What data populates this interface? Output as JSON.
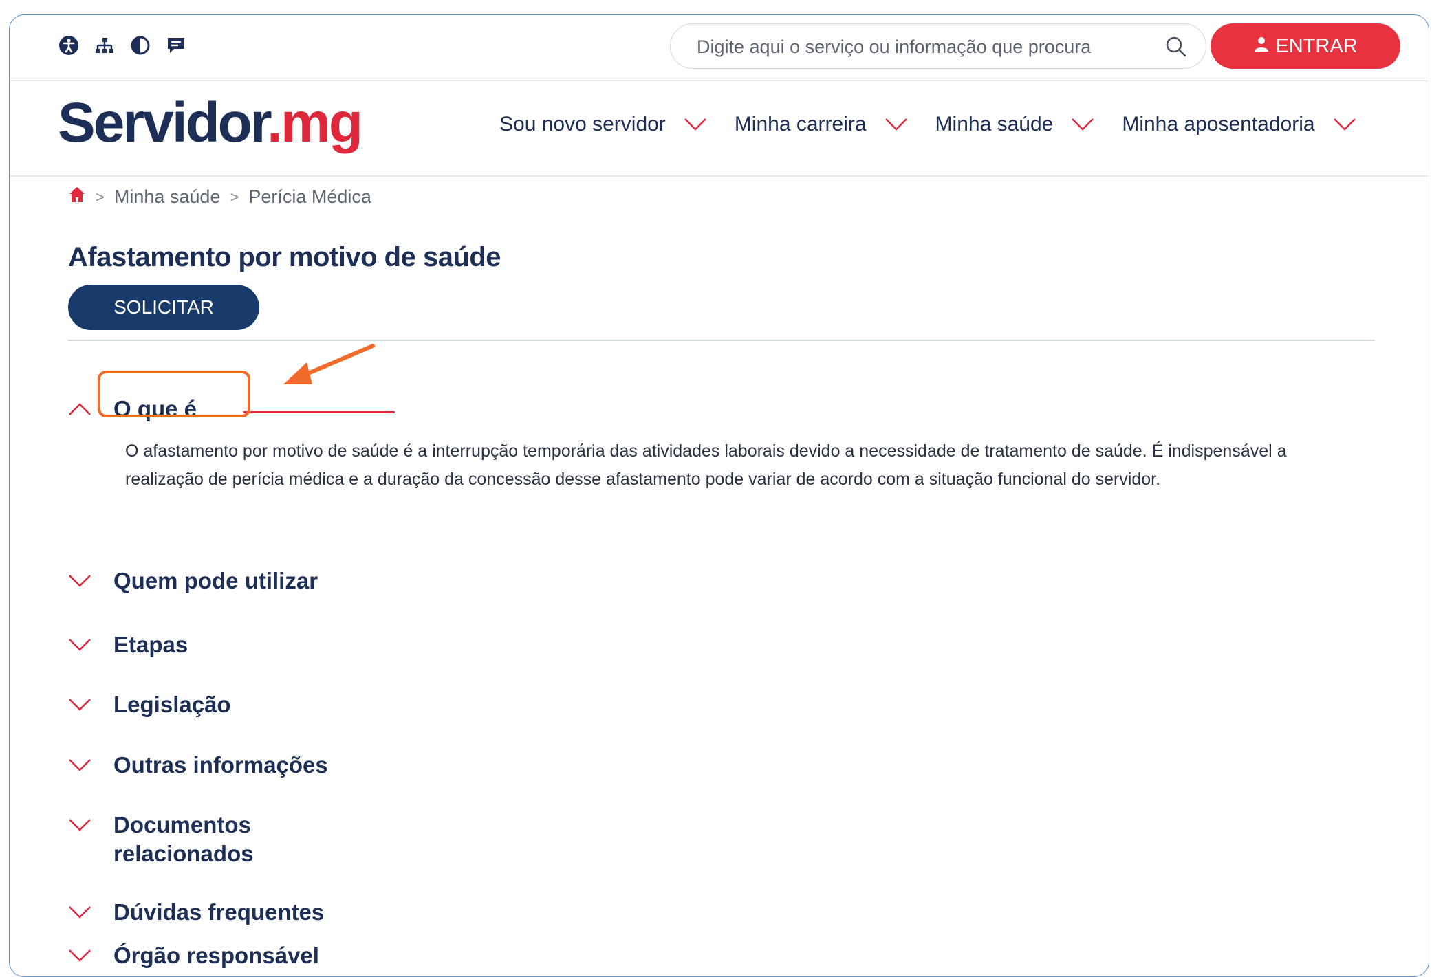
{
  "search": {
    "placeholder": "Digite aqui o serviço ou informação que procura"
  },
  "login": {
    "label": "ENTRAR"
  },
  "a11y_icons": [
    "accessibility-icon",
    "sitemap-icon",
    "contrast-icon",
    "feedback-icon"
  ],
  "logo": {
    "part1": "Servidor",
    "part2": ".mg"
  },
  "nav": {
    "items": [
      {
        "label": "Sou novo servidor"
      },
      {
        "label": "Minha carreira"
      },
      {
        "label": "Minha saúde"
      },
      {
        "label": "Minha aposentadoria"
      }
    ]
  },
  "breadcrumb": {
    "sep": ">",
    "items": [
      "Minha saúde",
      "Perícia Médica"
    ]
  },
  "page": {
    "title": "Afastamento por motivo de saúde",
    "button": "SOLICITAR"
  },
  "accordion": [
    {
      "label": "O que é",
      "open": true,
      "text": "O afastamento por motivo de saúde é a interrupção temporária das atividades laborais devido a necessidade de tratamento de saúde. É indispensável a realização de perícia médica e a duração da concessão desse afastamento pode variar de acordo com a situação funcional do servidor."
    },
    {
      "label": "Quem pode utilizar"
    },
    {
      "label": "Etapas"
    },
    {
      "label": "Legislação"
    },
    {
      "label": "Outras informações"
    },
    {
      "label": "Documentos relacionados"
    },
    {
      "label": "Dúvidas frequentes"
    },
    {
      "label": "Órgão responsável"
    }
  ],
  "colors": {
    "brand_blue": "#1d2f57",
    "brand_red": "#e0283d",
    "annotation": "#f06a2a"
  }
}
